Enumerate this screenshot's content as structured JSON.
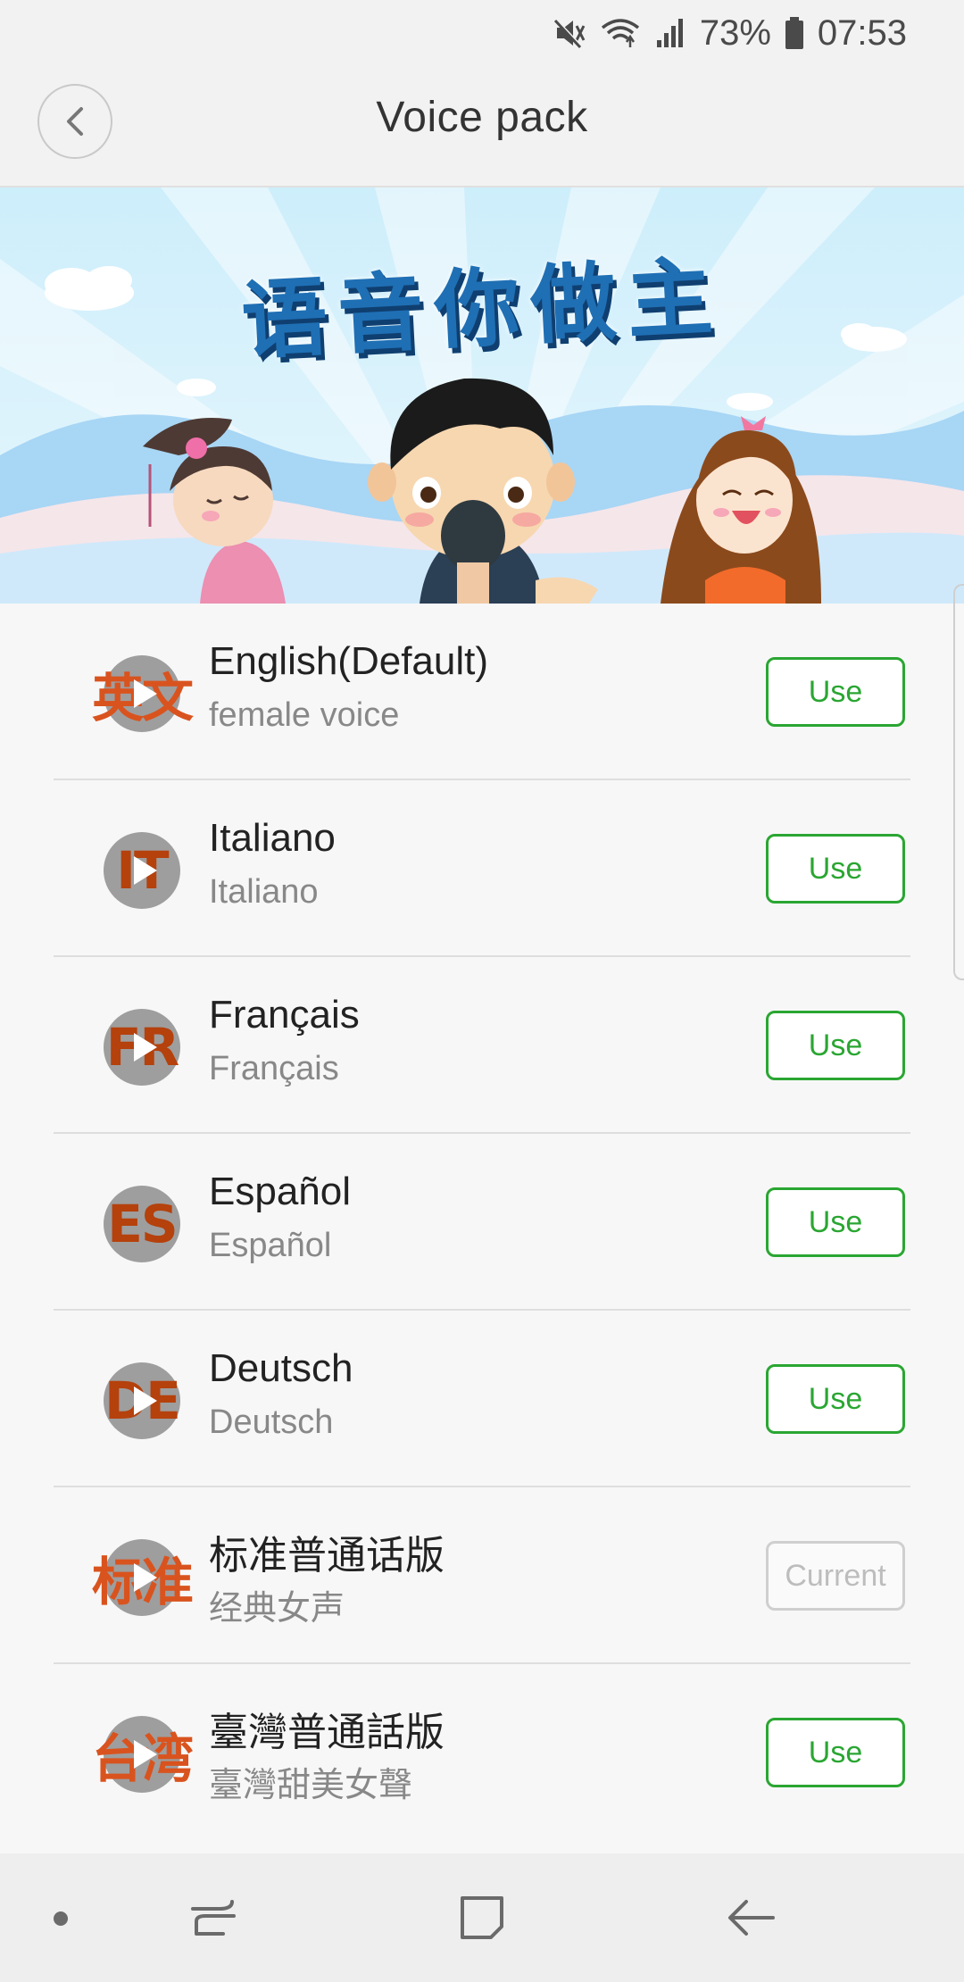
{
  "status_bar": {
    "battery_percent": "73%",
    "time": "07:53",
    "icons": [
      "mute-icon",
      "wifi-icon",
      "signal-icon",
      "battery-icon"
    ]
  },
  "header": {
    "title": "Voice pack",
    "back_icon": "chevron-left-icon"
  },
  "banner": {
    "title": "语音你做主"
  },
  "voice_packs": [
    {
      "code": "英文",
      "name": "English(Default)",
      "desc": "female voice",
      "action": "Use",
      "current": false
    },
    {
      "code": "IT",
      "name": "Italiano",
      "desc": "Italiano",
      "action": "Use",
      "current": false
    },
    {
      "code": "FR",
      "name": "Français",
      "desc": "Français",
      "action": "Use",
      "current": false
    },
    {
      "code": "ES",
      "name": "Español",
      "desc": "Español",
      "action": "Use",
      "current": false
    },
    {
      "code": "DE",
      "name": "Deutsch",
      "desc": "Deutsch",
      "action": "Use",
      "current": false
    },
    {
      "code": "标准",
      "name": "标准普通话版",
      "desc": "经典女声",
      "action": "Current",
      "current": true
    },
    {
      "code": "台湾",
      "name": "臺灣普通話版",
      "desc": "臺灣甜美女聲",
      "action": "Use",
      "current": false
    }
  ],
  "nav_bar": {
    "icons": [
      "dot-icon",
      "recents-icon",
      "home-icon",
      "back-icon"
    ]
  },
  "colors": {
    "accent_green": "#2aa632",
    "icon_orange": "#d9531e",
    "banner_title_blue": "#1f6fb4"
  }
}
